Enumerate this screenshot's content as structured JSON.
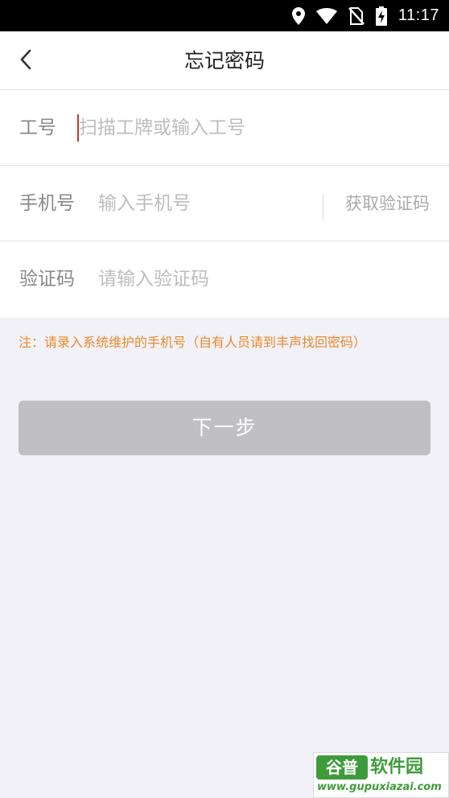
{
  "status_bar": {
    "time": "11:17",
    "icons": [
      "location-icon",
      "wifi-icon",
      "no-sim-icon",
      "battery-charging-icon"
    ]
  },
  "header": {
    "title": "忘记密码",
    "back_icon": "chevron-left-icon"
  },
  "form": {
    "employee_id": {
      "label": "工号",
      "placeholder": "扫描工牌或输入工号",
      "value": ""
    },
    "phone": {
      "label": "手机号",
      "placeholder": "输入手机号",
      "value": "",
      "get_code_label": "获取验证码"
    },
    "code": {
      "label": "验证码",
      "placeholder": "请输入验证码",
      "value": ""
    }
  },
  "note": "注：请录入系统维护的手机号（自有人员请到丰声找回密码）",
  "next_button": {
    "label": "下一步",
    "enabled": false
  },
  "watermark": {
    "logo_text": "谷普",
    "name": "软件园",
    "url": "www.gupuxiazai.com"
  },
  "colors": {
    "note": "#e98a2c",
    "button_disabled": "#c0c0c2",
    "background": "#f2f1f7",
    "caret": "#c0392b",
    "watermark": "#3e9b3a"
  }
}
